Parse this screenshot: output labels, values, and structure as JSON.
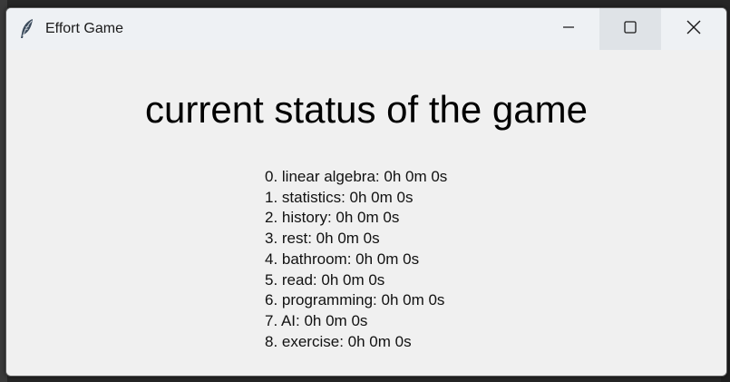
{
  "window": {
    "title": "Effort Game",
    "icon": "feather-icon"
  },
  "controls": {
    "minimize_icon": "minimize-icon",
    "maximize_icon": "maximize-icon",
    "close_icon": "close-icon"
  },
  "main": {
    "heading": "current status of the game",
    "items": [
      "0. linear algebra: 0h 0m 0s",
      "1. statistics: 0h 0m 0s",
      "2. history: 0h 0m 0s",
      "3. rest: 0h 0m 0s",
      "4. bathroom: 0h 0m 0s",
      "5. read: 0h 0m 0s",
      "6. programming: 0h 0m 0s",
      "7. AI: 0h 0m 0s",
      "8. exercise: 0h 0m 0s"
    ]
  },
  "colors": {
    "window_bg": "#f0f0f0",
    "titlebar_bg": "#eef1f4",
    "maximize_hover": "#dfe3e7",
    "text": "#000000"
  }
}
